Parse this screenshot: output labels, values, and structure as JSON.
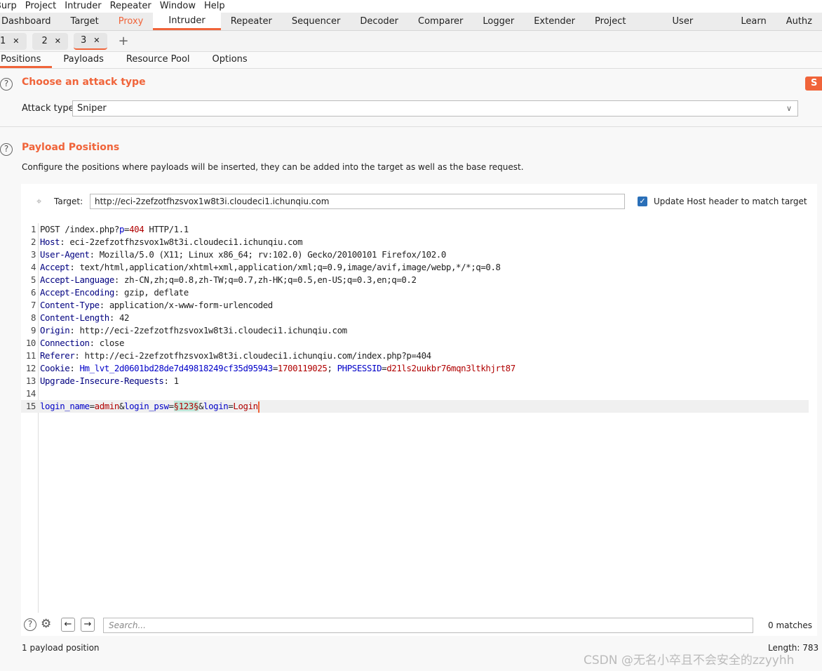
{
  "menu": [
    "Burp",
    "Project",
    "Intruder",
    "Repeater",
    "Window",
    "Help"
  ],
  "main_tabs": [
    "Dashboard",
    "Target",
    "Proxy",
    "Intruder",
    "Repeater",
    "Sequencer",
    "Decoder",
    "Comparer",
    "Logger",
    "Extender",
    "Project options",
    "User options",
    "Learn",
    "Authz"
  ],
  "sub_tabs": [
    "1",
    "2",
    "3"
  ],
  "inner_tabs": [
    "Positions",
    "Payloads",
    "Resource Pool",
    "Options"
  ],
  "attack": {
    "title": "Choose an attack type",
    "label": "Attack type:",
    "value": "Sniper",
    "start": "S"
  },
  "positions": {
    "title": "Payload Positions",
    "desc": "Configure the positions where payloads will be inserted, they can be added into the target as well as the base request.",
    "target_label": "Target:",
    "target_value": "http://eci-2zefzotfhzsvox1w8t3i.cloudeci1.ichunqiu.com",
    "update_host": "Update Host header to match target",
    "update_host_checked": true
  },
  "request_lines": [
    [
      [
        "POST /index.php?",
        "n"
      ],
      [
        "p",
        "p"
      ],
      [
        "=",
        "n"
      ],
      [
        "404",
        "v"
      ],
      [
        " HTTP/1.1",
        "n"
      ]
    ],
    [
      [
        "Host",
        "h"
      ],
      [
        ": eci-2zefzotfhzsvox1w8t3i.cloudeci1.ichunqiu.com",
        "n"
      ]
    ],
    [
      [
        "User-Agent",
        "h"
      ],
      [
        ": Mozilla/5.0 (X11; Linux x86_64; rv:102.0) Gecko/20100101 Firefox/102.0",
        "n"
      ]
    ],
    [
      [
        "Accept",
        "h"
      ],
      [
        ": text/html,application/xhtml+xml,application/xml;q=0.9,image/avif,image/webp,*/*;q=0.8",
        "n"
      ]
    ],
    [
      [
        "Accept-Language",
        "h"
      ],
      [
        ": zh-CN,zh;q=0.8,zh-TW;q=0.7,zh-HK;q=0.5,en-US;q=0.3,en;q=0.2",
        "n"
      ]
    ],
    [
      [
        "Accept-Encoding",
        "h"
      ],
      [
        ": gzip, deflate",
        "n"
      ]
    ],
    [
      [
        "Content-Type",
        "h"
      ],
      [
        ": application/x-www-form-urlencoded",
        "n"
      ]
    ],
    [
      [
        "Content-Length",
        "h"
      ],
      [
        ": 42",
        "n"
      ]
    ],
    [
      [
        "Origin",
        "h"
      ],
      [
        ": http://eci-2zefzotfhzsvox1w8t3i.cloudeci1.ichunqiu.com",
        "n"
      ]
    ],
    [
      [
        "Connection",
        "h"
      ],
      [
        ": close",
        "n"
      ]
    ],
    [
      [
        "Referer",
        "h"
      ],
      [
        ": http://eci-2zefzotfhzsvox1w8t3i.cloudeci1.ichunqiu.com/index.php?p=404",
        "n"
      ]
    ],
    [
      [
        "Cookie",
        "h"
      ],
      [
        ": ",
        "n"
      ],
      [
        "Hm_lvt_2d0601bd28de7d49818249cf35d95943",
        "p"
      ],
      [
        "=",
        "n"
      ],
      [
        "1700119025",
        "v"
      ],
      [
        "; ",
        "n"
      ],
      [
        "PHPSESSID",
        "p"
      ],
      [
        "=",
        "n"
      ],
      [
        "d21ls2uukbr76mqn3ltkhjrt87",
        "v"
      ]
    ],
    [
      [
        "Upgrade-Insecure-Requests",
        "h"
      ],
      [
        ": 1",
        "n"
      ]
    ],
    [],
    [
      [
        "login_name",
        "p"
      ],
      [
        "=",
        "n"
      ],
      [
        "admin",
        "v"
      ],
      [
        "&",
        "n"
      ],
      [
        "login_psw",
        "p"
      ],
      [
        "=",
        "n"
      ],
      [
        "§123§",
        "m"
      ],
      [
        "&",
        "n"
      ],
      [
        "login",
        "p"
      ],
      [
        "=",
        "n"
      ],
      [
        "Login",
        "v"
      ]
    ]
  ],
  "search": {
    "placeholder": "Search...",
    "matches": "0 matches"
  },
  "status": {
    "positions": "1 payload position",
    "length": "Length: 783"
  },
  "watermark": "CSDN @无名小卒且不会安全的zzyyhh",
  "colors": {
    "accent": "#f0643a"
  }
}
